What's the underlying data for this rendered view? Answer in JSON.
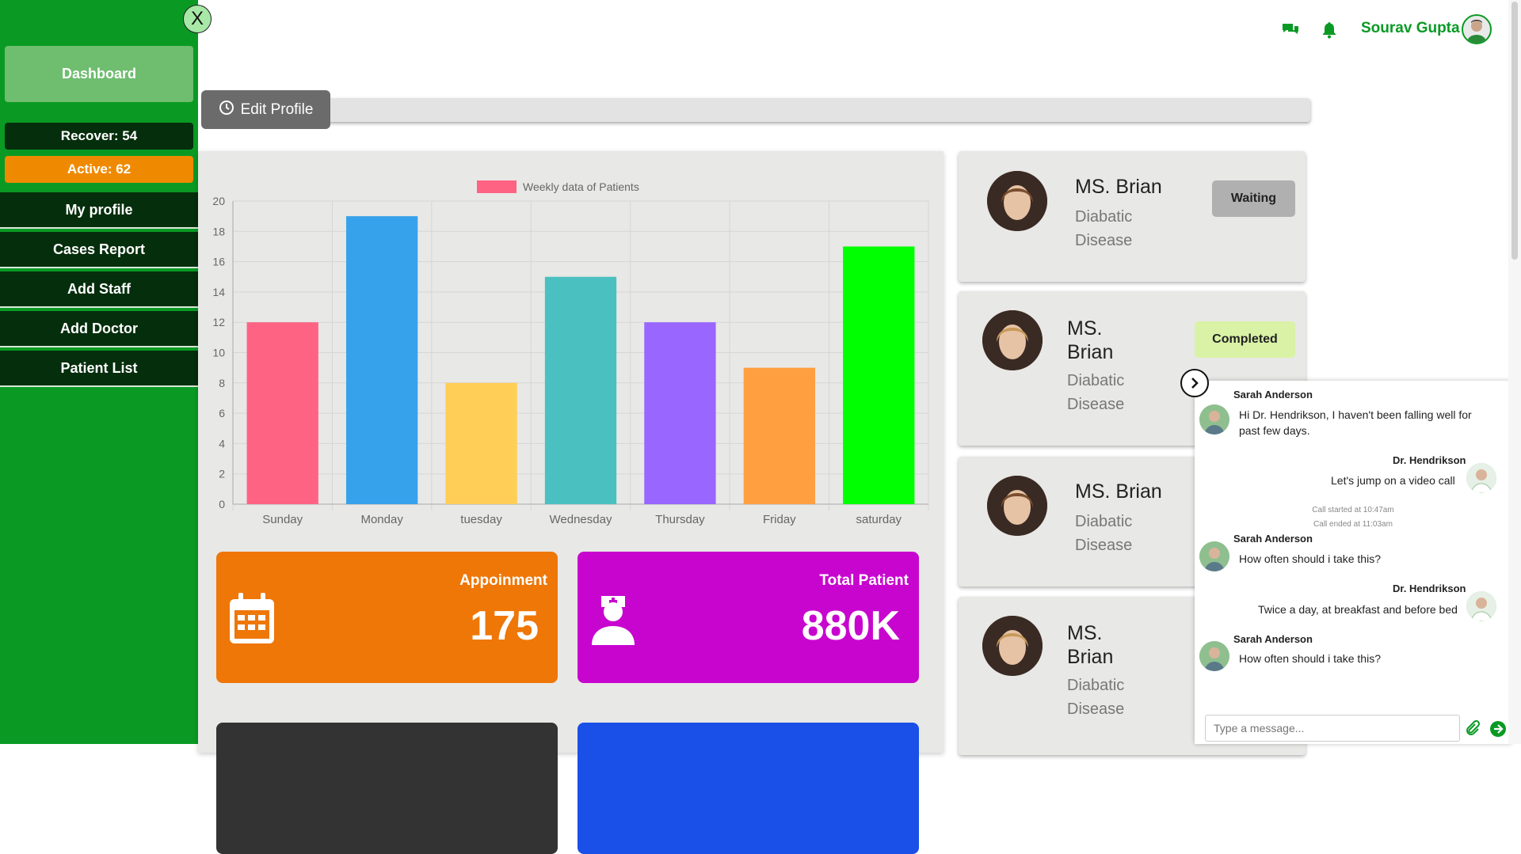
{
  "sidebar": {
    "close_label": "X",
    "dashboard_label": "Dashboard",
    "recover_label": "Recover: 54",
    "active_label": "Active: 62",
    "items": [
      {
        "label": "My profile"
      },
      {
        "label": "Cases Report"
      },
      {
        "label": "Add Staff"
      },
      {
        "label": "Add Doctor"
      },
      {
        "label": "Patient List"
      }
    ]
  },
  "header": {
    "user_name": "Sourav Gupta",
    "icons": [
      "chat-icon",
      "bell-icon"
    ],
    "accent_color": "#0a9a24"
  },
  "toolbar": {
    "edit_profile_label": "Edit Profile"
  },
  "chart_data": {
    "type": "bar",
    "legend": "Weekly data of Patients",
    "categories": [
      "Sunday",
      "Monday",
      "tuesday",
      "Wednesday",
      "Thursday",
      "Friday",
      "saturday"
    ],
    "values": [
      12,
      19,
      8,
      15,
      12,
      9,
      17
    ],
    "colors": [
      "#ff6384",
      "#36a2eb",
      "#ffce56",
      "#4bc0c0",
      "#9966ff",
      "#ff9f40",
      "#00ff00"
    ],
    "ylim": [
      0,
      20
    ],
    "yticks": [
      0,
      2,
      4,
      6,
      8,
      10,
      12,
      14,
      16,
      18,
      20
    ],
    "grid": true,
    "legend_position": "top"
  },
  "cards": [
    {
      "title": "Appoinment",
      "value": "175",
      "icon": "calendar-icon",
      "color": "#ee7708"
    },
    {
      "title": "Total Patient",
      "value": "880K",
      "icon": "nurse-icon",
      "color": "#c805cf"
    }
  ],
  "patients": [
    {
      "name": "MS. Brian",
      "disease_line1": "Diabatic",
      "disease_line2": "Disease",
      "status": "Waiting"
    },
    {
      "name_line1": "MS.",
      "name_line2": "Brian",
      "disease_line1": "Diabatic",
      "disease_line2": "Disease",
      "status": "Completed"
    },
    {
      "name": "MS. Brian",
      "disease_line1": "Diabatic",
      "disease_line2": "Disease"
    },
    {
      "name_line1": "MS.",
      "name_line2": "Brian",
      "disease_line1": "Diabatic",
      "disease_line2": "Disease"
    }
  ],
  "chat": {
    "messages": [
      {
        "sender": "Sarah Anderson",
        "line1": "Hi Dr. Hendrikson, I haven't been falling well for",
        "line2": "past few days."
      },
      {
        "sender": "Dr. Hendrikson",
        "text": "Let's jump on a video call"
      },
      {
        "sender": "Sarah Anderson",
        "text": "How often should i take this?"
      },
      {
        "sender": "Dr. Hendrikson",
        "text": "Twice a day, at breakfast and before bed"
      },
      {
        "sender": "Sarah Anderson",
        "text": "How often should i take this?"
      }
    ],
    "call_started": "Call started at 10:47am",
    "call_ended": "Call ended at 11:03am",
    "input_placeholder": "Type a message..."
  }
}
